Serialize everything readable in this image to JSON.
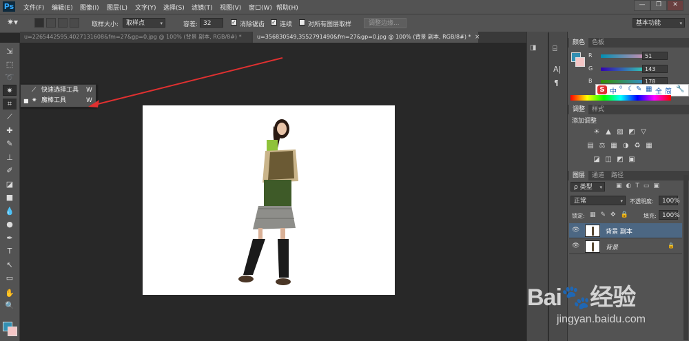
{
  "app": {
    "logo": "Ps"
  },
  "menu": [
    "文件(F)",
    "编辑(E)",
    "图像(I)",
    "图层(L)",
    "文字(Y)",
    "选择(S)",
    "滤镜(T)",
    "视图(V)",
    "窗口(W)",
    "帮助(H)"
  ],
  "window_controls": {
    "minimize": "—",
    "restore": "❐",
    "close": "✕"
  },
  "options": {
    "sample_size_label": "取样大小:",
    "sample_size_value": "取样点",
    "tolerance_label": "容差:",
    "tolerance_value": "32",
    "anti_alias_label": "消除锯齿",
    "anti_alias_checked": true,
    "contiguous_label": "连续",
    "contiguous_checked": true,
    "all_layers_label": "对所有图层取样",
    "all_layers_checked": false,
    "refine_edge_label": "调整边缘...",
    "workspace_value": "基本功能"
  },
  "tabs": [
    {
      "label": "u=2265442595,4027131608&fm=27&gp=0.jpg @ 100% (背景 副本, RGB/8#) *",
      "active": false
    },
    {
      "label": "u=356830549,3552791490&fm=27&gp=0.jpg @ 100% (背景 副本, RGB/8#) *",
      "active": true
    }
  ],
  "tab_close": "×",
  "flyout": {
    "items": [
      {
        "label": "快速选择工具",
        "shortcut": "W",
        "selected": false
      },
      {
        "label": "魔棒工具",
        "shortcut": "W",
        "selected": true
      }
    ]
  },
  "color_panel": {
    "tabs": [
      "颜色",
      "色板"
    ],
    "r_label": "R",
    "r_value": "51",
    "g_label": "G",
    "g_value": "143",
    "b_label": "B",
    "b_value": "178",
    "foreground": "#338fb2",
    "background": "#f4c6c6"
  },
  "ime_toolbar": {
    "logo": "S",
    "items": [
      "中",
      "⁰",
      "☾",
      "✎",
      "▦",
      "全",
      "简",
      "🔧"
    ]
  },
  "adjustments_panel": {
    "tabs": [
      "调整",
      "样式"
    ],
    "title": "添加调整",
    "row1": [
      "☀",
      "▲",
      "▨",
      "◩",
      "▽"
    ],
    "row2": [
      "▤",
      "⚖",
      "▦",
      "◑",
      "♻",
      "▦"
    ],
    "row3": [
      "◪",
      "◫",
      "◩",
      "▣"
    ]
  },
  "layers_panel": {
    "tabs": [
      "图层",
      "通道",
      "路径"
    ],
    "filter_value": "ρ 类型",
    "blend_mode": "正常",
    "opacity_label": "不透明度:",
    "opacity_value": "100%",
    "lock_label": "锁定:",
    "fill_label": "填充:",
    "fill_value": "100%",
    "layers": [
      {
        "name": "背景 副本",
        "selected": true,
        "locked": false
      },
      {
        "name": "背景",
        "selected": false,
        "locked": true
      }
    ]
  },
  "watermark": {
    "logo": "Bai🐾经验",
    "url": "jingyan.baidu.com"
  },
  "colors": {
    "arrow": "#e03030",
    "panel_bg": "#535353",
    "workspace_bg": "#282828",
    "selection_blue": "#4c6783"
  }
}
